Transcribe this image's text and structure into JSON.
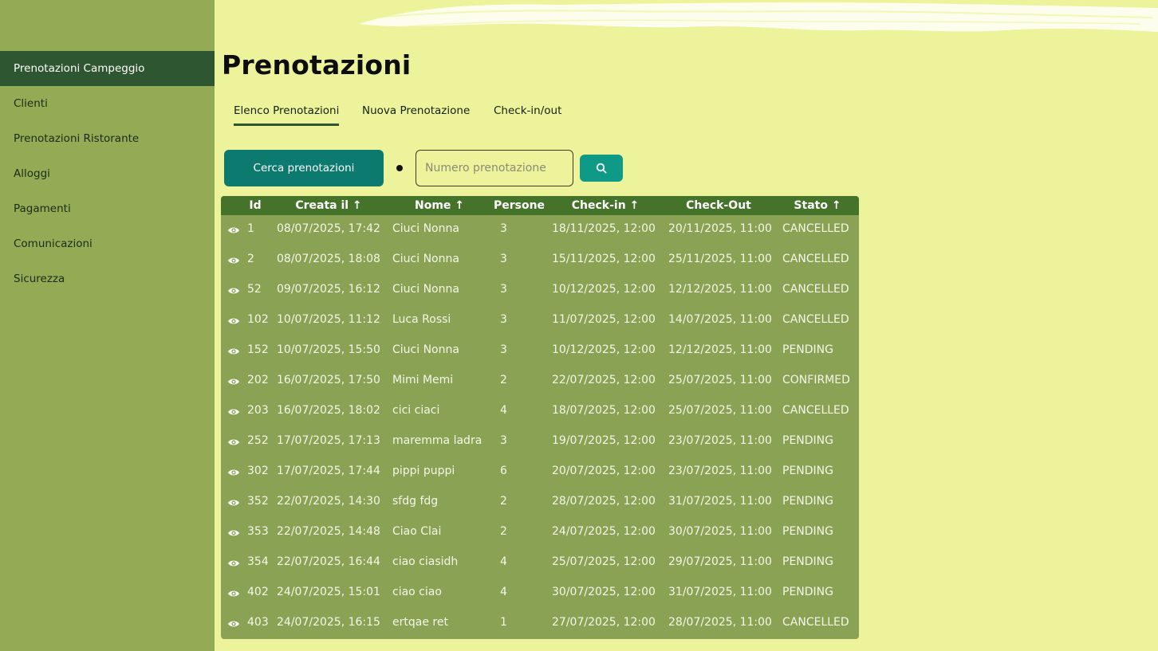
{
  "sidebar": {
    "items": [
      {
        "label": "Prenotazioni Campeggio",
        "active": true
      },
      {
        "label": "Clienti"
      },
      {
        "label": "Prenotazioni Ristorante"
      },
      {
        "label": "Alloggi"
      },
      {
        "label": "Pagamenti"
      },
      {
        "label": "Comunicazioni"
      },
      {
        "label": "Sicurezza"
      }
    ]
  },
  "page": {
    "title": "Prenotazioni"
  },
  "tabs": [
    {
      "label": "Elenco Prenotazioni",
      "active": true
    },
    {
      "label": "Nuova Prenotazione"
    },
    {
      "label": "Check-in/out"
    }
  ],
  "search": {
    "button_label": "Cerca prenotazioni",
    "placeholder": "Numero prenotazione",
    "icon": "search-icon"
  },
  "table": {
    "headers": [
      "Id",
      "Creata il ↑",
      "Nome ↑",
      "Persone",
      "Check-in ↑",
      "Check-Out",
      "Stato ↑"
    ],
    "rows": [
      {
        "id": "1",
        "created": "08/07/2025, 17:42",
        "name": "Ciuci Nonna",
        "people": "3",
        "checkin": "18/11/2025, 12:00",
        "checkout": "20/11/2025, 11:00",
        "status": "CANCELLED"
      },
      {
        "id": "2",
        "created": "08/07/2025, 18:08",
        "name": "Ciuci Nonna",
        "people": "3",
        "checkin": "15/11/2025, 12:00",
        "checkout": "25/11/2025, 11:00",
        "status": "CANCELLED"
      },
      {
        "id": "52",
        "created": "09/07/2025, 16:12",
        "name": "Ciuci Nonna",
        "people": "3",
        "checkin": "10/12/2025, 12:00",
        "checkout": "12/12/2025, 11:00",
        "status": "CANCELLED"
      },
      {
        "id": "102",
        "created": "10/07/2025, 11:12",
        "name": "Luca Rossi",
        "people": "3",
        "checkin": "11/07/2025, 12:00",
        "checkout": "14/07/2025, 11:00",
        "status": "CANCELLED"
      },
      {
        "id": "152",
        "created": "10/07/2025, 15:50",
        "name": "Ciuci Nonna",
        "people": "3",
        "checkin": "10/12/2025, 12:00",
        "checkout": "12/12/2025, 11:00",
        "status": "PENDING"
      },
      {
        "id": "202",
        "created": "16/07/2025, 17:50",
        "name": "Mimi Memi",
        "people": "2",
        "checkin": "22/07/2025, 12:00",
        "checkout": "25/07/2025, 11:00",
        "status": "CONFIRMED"
      },
      {
        "id": "203",
        "created": "16/07/2025, 18:02",
        "name": "cici ciaci",
        "people": "4",
        "checkin": "18/07/2025, 12:00",
        "checkout": "25/07/2025, 11:00",
        "status": "CANCELLED"
      },
      {
        "id": "252",
        "created": "17/07/2025, 17:13",
        "name": "maremma ladra",
        "people": "3",
        "checkin": "19/07/2025, 12:00",
        "checkout": "23/07/2025, 11:00",
        "status": "PENDING"
      },
      {
        "id": "302",
        "created": "17/07/2025, 17:44",
        "name": "pippi puppi",
        "people": "6",
        "checkin": "20/07/2025, 12:00",
        "checkout": "23/07/2025, 11:00",
        "status": "PENDING"
      },
      {
        "id": "352",
        "created": "22/07/2025, 14:30",
        "name": "sfdg fdg",
        "people": "2",
        "checkin": "28/07/2025, 12:00",
        "checkout": "31/07/2025, 11:00",
        "status": "PENDING"
      },
      {
        "id": "353",
        "created": "22/07/2025, 14:48",
        "name": "Ciao Clai",
        "people": "2",
        "checkin": "24/07/2025, 12:00",
        "checkout": "30/07/2025, 11:00",
        "status": "PENDING"
      },
      {
        "id": "354",
        "created": "22/07/2025, 16:44",
        "name": "ciao ciasidh",
        "people": "4",
        "checkin": "25/07/2025, 12:00",
        "checkout": "29/07/2025, 11:00",
        "status": "PENDING"
      },
      {
        "id": "402",
        "created": "24/07/2025, 15:01",
        "name": "ciao ciao",
        "people": "4",
        "checkin": "30/07/2025, 12:00",
        "checkout": "31/07/2025, 11:00",
        "status": "PENDING"
      },
      {
        "id": "403",
        "created": "24/07/2025, 16:15",
        "name": "ertqae ret",
        "people": "1",
        "checkin": "27/07/2025, 12:00",
        "checkout": "28/07/2025, 11:00",
        "status": "CANCELLED"
      }
    ]
  },
  "colors": {
    "background": "#ecf39b",
    "sidebar": "#93ab55",
    "sidebar_active": "#2e5630",
    "primary_button": "#0c7a6e",
    "table_header": "#46732a",
    "table_body": "#8aa253"
  }
}
